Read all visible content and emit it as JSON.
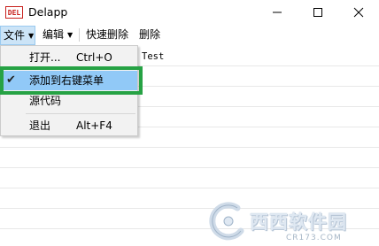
{
  "window": {
    "icon_text": "DEL",
    "title": "Delapp"
  },
  "menubar": {
    "file": "文件",
    "edit": "编辑",
    "quick_delete": "快速删除",
    "delete": "删除"
  },
  "file_menu": {
    "items": [
      {
        "label": "打开...",
        "shortcut": "Ctrl+O"
      },
      {
        "label": "添加到右键菜单",
        "checked": true
      },
      {
        "label": "源代码"
      },
      {
        "label": "退出",
        "shortcut": "Alt+F4"
      }
    ]
  },
  "content": {
    "cell_text": "Test"
  },
  "watermark": {
    "brand": "西西软件园",
    "url": "CR173.COM"
  },
  "colors": {
    "highlight_border": "#26a244",
    "menu_hover": "#91c9f7",
    "icon_red": "#c8201c"
  }
}
